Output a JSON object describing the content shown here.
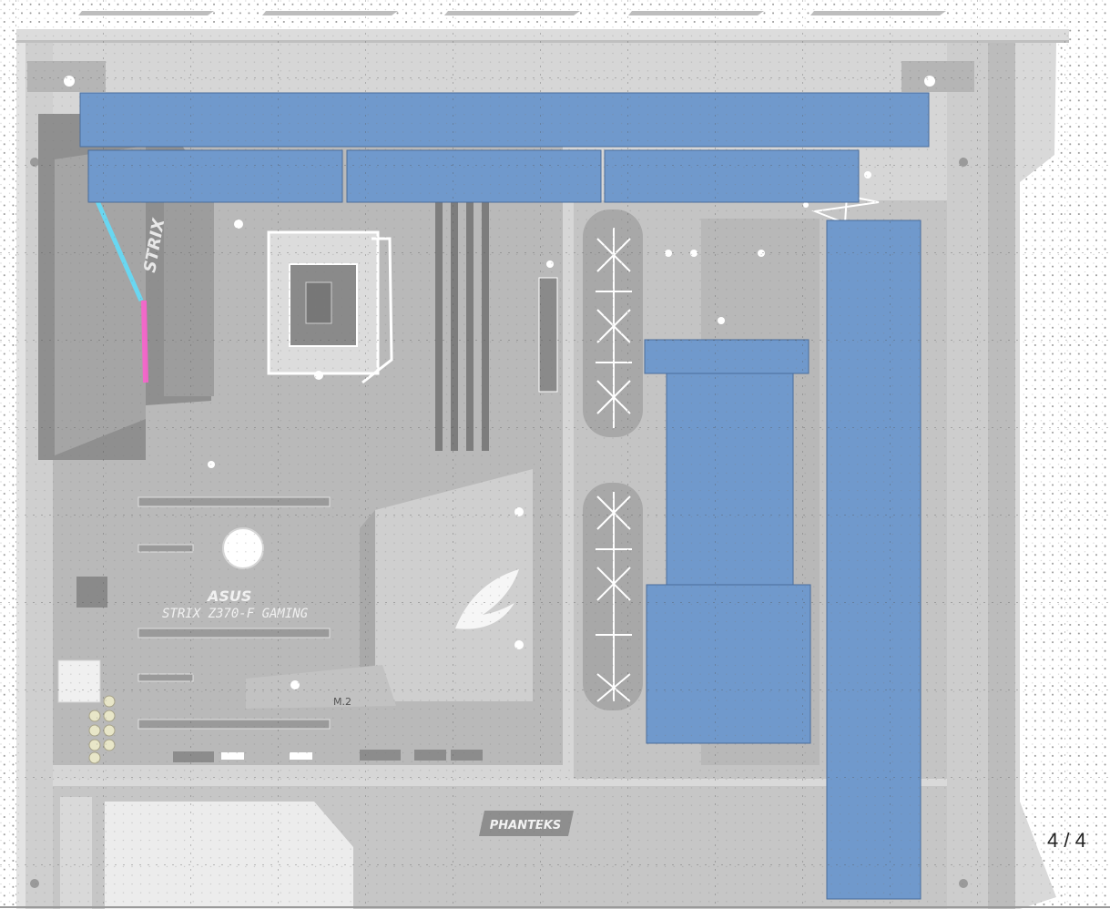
{
  "colors": {
    "block_fill": "#7099cc",
    "block_stroke": "#4a6d9c",
    "case_light": "#e4e4e4",
    "case_mid": "#c9c9c9",
    "case_dark": "#a8a8a8",
    "board": "#b9b9b9",
    "board_dark": "#9e9e9e",
    "rgb_cyan": "#5fe0ff",
    "rgb_pink": "#ff5fd0"
  },
  "board_text": {
    "brand": "ASUS",
    "model": "STRIX Z370-F GAMING",
    "side_label": "STRIX",
    "slot_label": "M.2"
  },
  "case_text": {
    "logo": "PHANTEKS"
  },
  "pager": {
    "text": "4 / 4"
  }
}
